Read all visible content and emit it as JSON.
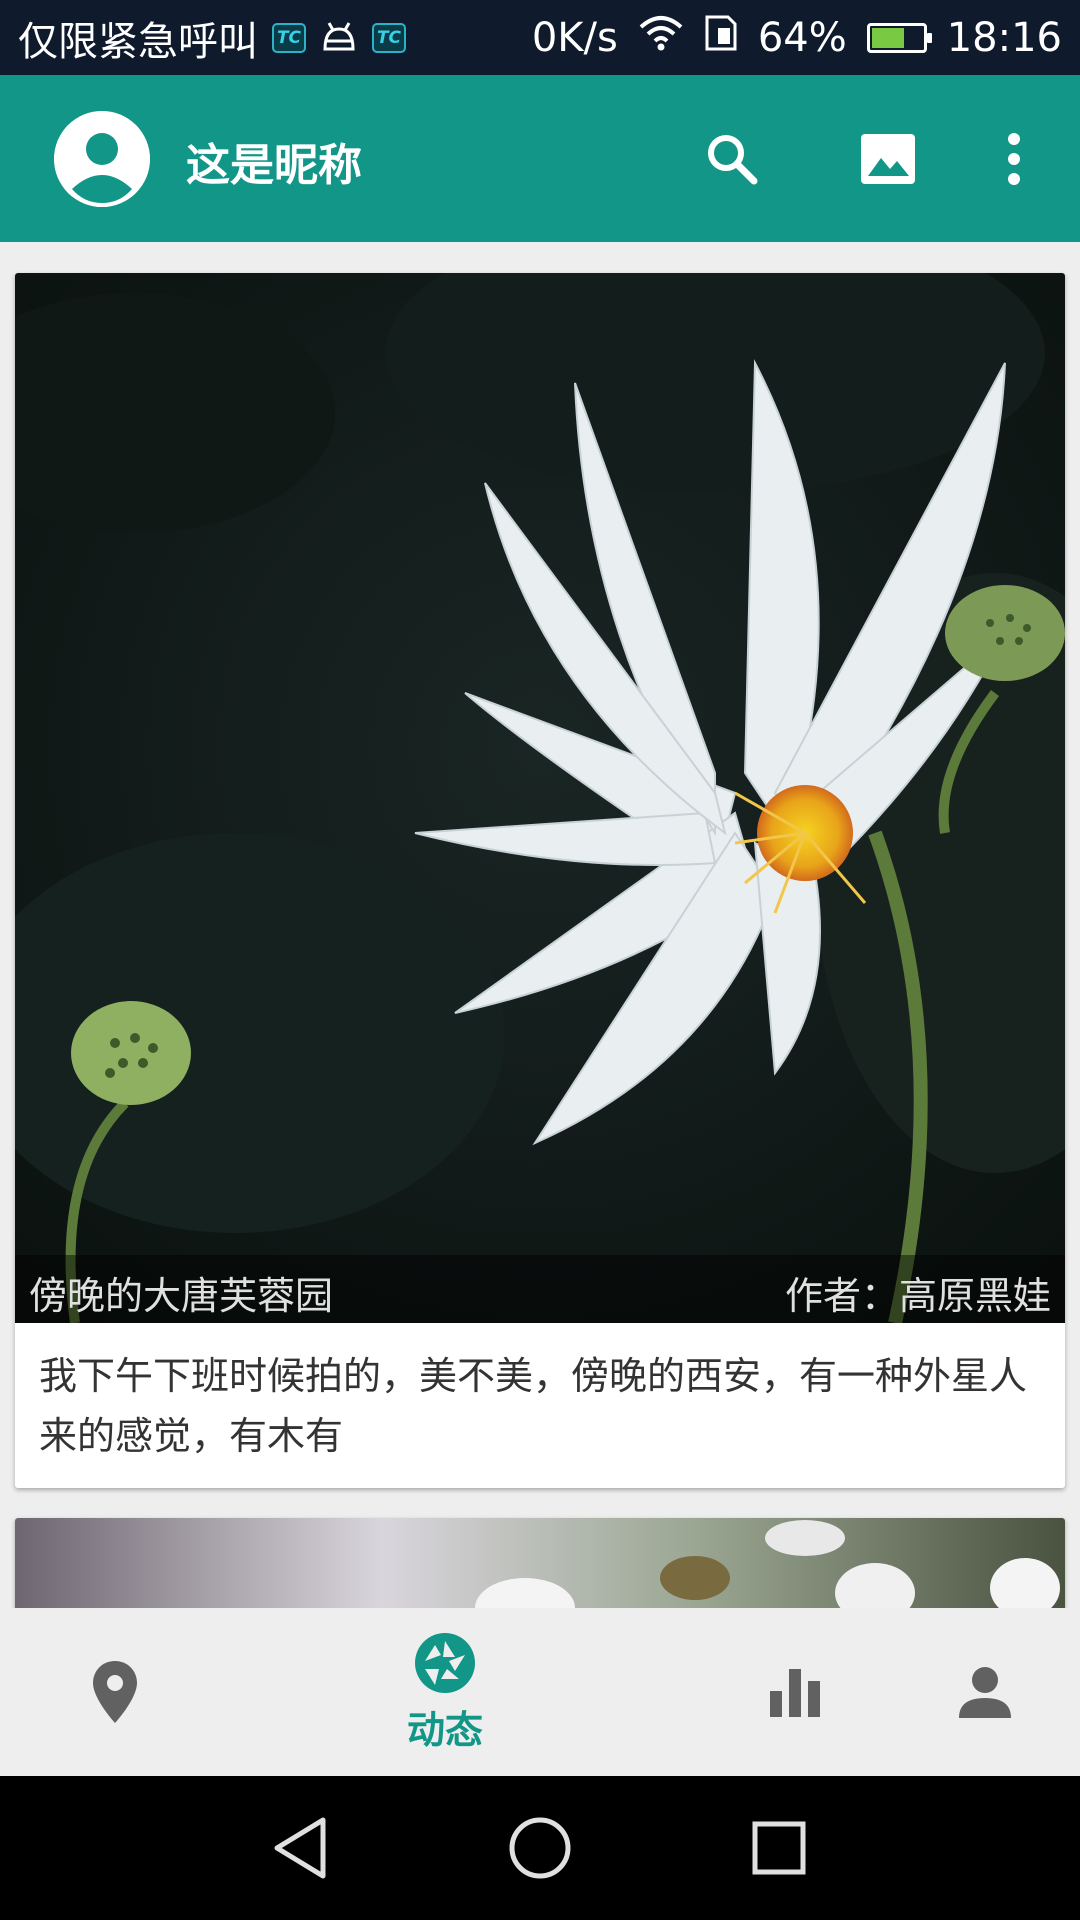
{
  "status_bar": {
    "carrier": "仅限紧急呼叫",
    "badge_text": "TC",
    "speed": "0K/s",
    "battery_percent": "64%",
    "battery_level": 0.64,
    "time": "18:16"
  },
  "app_bar": {
    "title": "这是昵称",
    "color": "#119688"
  },
  "feed": {
    "posts": [
      {
        "title": "傍晚的大唐芙蓉园",
        "author": "作者：高原黑娃",
        "description": "我下午下班时候拍的，美不美，傍晚的西安，有一种外星人来的感觉，有木有"
      }
    ]
  },
  "bottom_nav": {
    "items": [
      {
        "icon": "location-icon"
      },
      {
        "icon": "camera-aperture-icon",
        "label": "动态",
        "active": true
      },
      {
        "icon": "bar-chart-icon"
      },
      {
        "icon": "person-icon"
      }
    ],
    "active_color": "#119688",
    "inactive_color": "#616161"
  },
  "system_nav": {
    "icons": [
      "back-icon",
      "home-icon",
      "recents-icon"
    ]
  }
}
